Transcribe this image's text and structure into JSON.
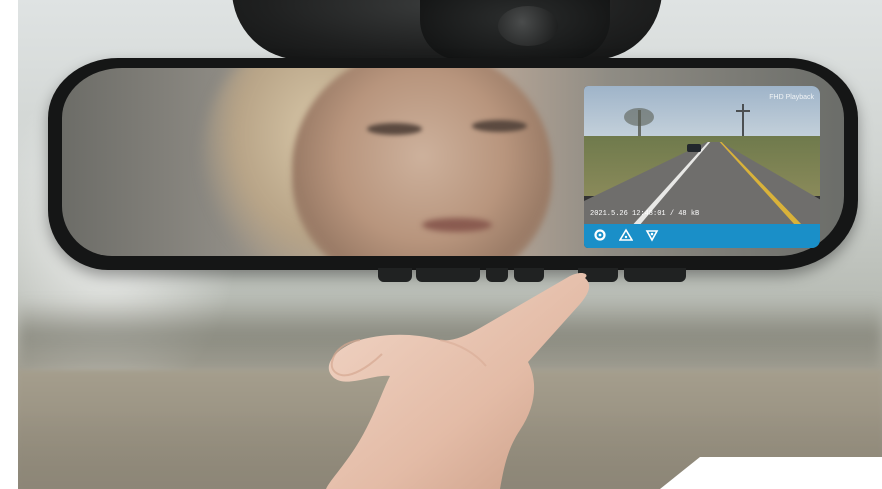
{
  "screen": {
    "rec_label": "FHD Playback",
    "timestamp": "2021.5.26 12:48:01 / 48 kB"
  },
  "toolbar": {
    "icons": [
      "settings-icon",
      "warning-icon",
      "navigation-icon"
    ]
  },
  "colors": {
    "toolbar": "#1a8fc8",
    "mirror_frame": "#151616"
  }
}
